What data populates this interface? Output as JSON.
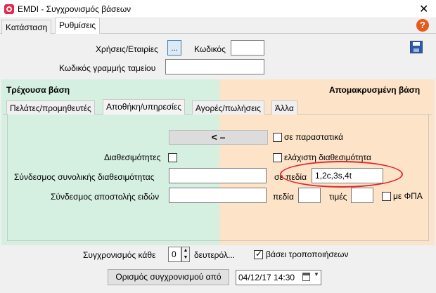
{
  "window": {
    "title": "EMDI - Συγχρονισμός βάσεων",
    "close": "✕"
  },
  "tabs": [
    "Κατάσταση",
    "Ρυθμίσεις"
  ],
  "help": "?",
  "top": {
    "years_label": "Χρήσεις/Εταιρίες",
    "dots_label": "...",
    "code_label": "Κωδικός",
    "code_value": "",
    "cash_code_label": "Κωδικός γραμμής ταμείου",
    "cash_code_value": ""
  },
  "panels": {
    "left_title": "Τρέχουσα βάση",
    "right_title": "Απομακρυσμένη βάση"
  },
  "inner_tabs": [
    "Πελάτες/προμηθευτές",
    "Αποθήκη/υπηρεσίες",
    "Αγορές/πωλήσεις",
    "Άλλα"
  ],
  "warehouse": {
    "arrow_label": "<  –",
    "in_docs_label": "σε παραστατικά",
    "availabilities_label": "Διαθεσιμότητες",
    "min_avail_label": "ελάχιστη διαθεσιμότητα",
    "total_avail_link_label": "Σύνδεσμος συνολικής διαθεσιμότητας",
    "total_avail_link_value": "",
    "in_fields_label": "σε πεδία",
    "in_fields_value": "1,2c,3s,4t",
    "ship_link_label": "Σύνδεσμος αποστολής ειδών",
    "ship_link_value": "",
    "fields_label": "πεδία",
    "fields_value": "",
    "prices_label": "τιμές",
    "prices_value": "",
    "with_vat_label": "με ΦΠΑ"
  },
  "bottom": {
    "sync_every_label": "Συγχρονισμός κάθε",
    "sync_value": "0",
    "seconds_label": "δευτερόλ...",
    "based_on_mod_label": "βάσει τροποποιήσεων",
    "based_on_mod_checked": true,
    "sync_from_button": "Ορισμός συγχρονισμού από",
    "date_value": "04/12/17 14:30"
  }
}
